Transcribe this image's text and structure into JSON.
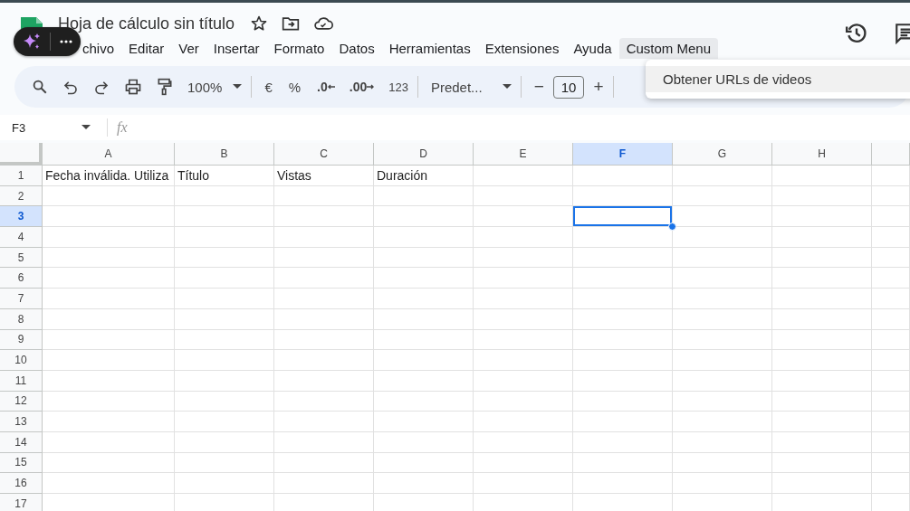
{
  "document": {
    "title": "Hoja de cálculo sin título"
  },
  "menu": [
    {
      "label": "chivo",
      "selected": false
    },
    {
      "label": "Editar",
      "selected": false
    },
    {
      "label": "Ver",
      "selected": false
    },
    {
      "label": "Insertar",
      "selected": false
    },
    {
      "label": "Formato",
      "selected": false
    },
    {
      "label": "Datos",
      "selected": false
    },
    {
      "label": "Herramientas",
      "selected": false
    },
    {
      "label": "Extensiones",
      "selected": false
    },
    {
      "label": "Ayuda",
      "selected": false
    },
    {
      "label": "Custom Menu",
      "selected": true
    }
  ],
  "dropdown": {
    "items": [
      {
        "label": "Obtener URLs de videos",
        "selected": true
      }
    ]
  },
  "toolbar": {
    "zoom": "100%",
    "currency": "€",
    "percent": "%",
    "decrease_decimal": ".0",
    "increase_decimal": ".00",
    "number_format": "123",
    "font": "Predet...",
    "font_size": "10",
    "minus": "−",
    "plus": "+"
  },
  "formula_bar": {
    "name_box": "F3",
    "fx": "fx"
  },
  "grid": {
    "columns": [
      {
        "label": "A",
        "selected": false
      },
      {
        "label": "B",
        "selected": false
      },
      {
        "label": "C",
        "selected": false
      },
      {
        "label": "D",
        "selected": false
      },
      {
        "label": "E",
        "selected": false
      },
      {
        "label": "F",
        "selected": true
      },
      {
        "label": "G",
        "selected": false
      },
      {
        "label": "H",
        "selected": false
      }
    ],
    "rows": [
      {
        "label": "1",
        "selected": false,
        "cells": [
          "Fecha inválida. Utiliza",
          "Título",
          "Vistas",
          "Duración"
        ]
      },
      {
        "label": "2",
        "selected": false
      },
      {
        "label": "3",
        "selected": true
      },
      {
        "label": "4",
        "selected": false
      },
      {
        "label": "5",
        "selected": false
      },
      {
        "label": "6",
        "selected": false
      },
      {
        "label": "7",
        "selected": false
      },
      {
        "label": "8",
        "selected": false
      },
      {
        "label": "9",
        "selected": false
      },
      {
        "label": "10",
        "selected": false
      },
      {
        "label": "11",
        "selected": false
      },
      {
        "label": "12",
        "selected": false
      },
      {
        "label": "13",
        "selected": false
      },
      {
        "label": "14",
        "selected": false
      },
      {
        "label": "15",
        "selected": false
      },
      {
        "label": "16",
        "selected": false
      },
      {
        "label": "17",
        "selected": false
      }
    ]
  }
}
